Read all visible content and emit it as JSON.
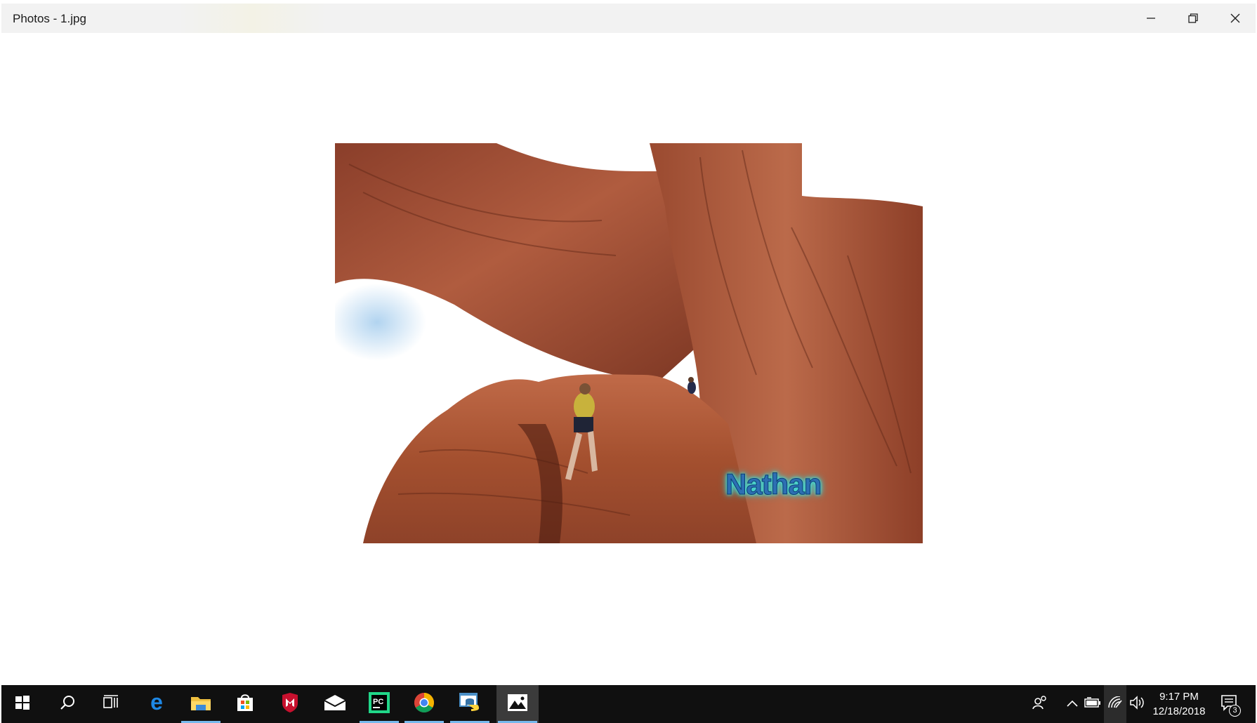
{
  "window": {
    "title": "Photos - 1.jpg",
    "controls": {
      "minimize_icon": "minimize-icon",
      "restore_icon": "restore-icon",
      "close_icon": "close-icon"
    }
  },
  "photo": {
    "description_icon": "image",
    "watermark_text": "Nathan",
    "colors": {
      "rock": "#a9553a",
      "rock_dark": "#6e2f1e",
      "sky": "#b9d9f0"
    }
  },
  "taskbar": {
    "pinned": [
      {
        "name": "start",
        "icon": "windows-logo-icon",
        "active": false
      },
      {
        "name": "search",
        "icon": "search-icon",
        "active": false
      },
      {
        "name": "task-view",
        "icon": "task-view-icon",
        "active": false
      },
      {
        "name": "edge",
        "icon": "edge-icon",
        "active": false
      },
      {
        "name": "file-explorer",
        "icon": "folder-icon",
        "active": true
      },
      {
        "name": "store",
        "icon": "store-icon",
        "active": false
      },
      {
        "name": "mcafee",
        "icon": "mcafee-icon",
        "active": false
      },
      {
        "name": "mail",
        "icon": "mail-icon",
        "active": false
      },
      {
        "name": "pycharm",
        "icon": "pycharm-icon",
        "active": true
      },
      {
        "name": "chrome",
        "icon": "chrome-icon",
        "active": true
      },
      {
        "name": "python",
        "icon": "python-icon",
        "active": true
      },
      {
        "name": "photos",
        "icon": "photos-icon",
        "active": true
      }
    ],
    "tray": {
      "people_icon": "people-icon",
      "chevron_icon": "chevron-up-icon",
      "battery_icon": "battery-icon",
      "network_icon": "wifi-icon",
      "volume_icon": "volume-icon",
      "time": "9:17 PM",
      "date": "12/18/2018",
      "notifications_icon": "action-center-icon",
      "notifications_count": "3"
    }
  }
}
